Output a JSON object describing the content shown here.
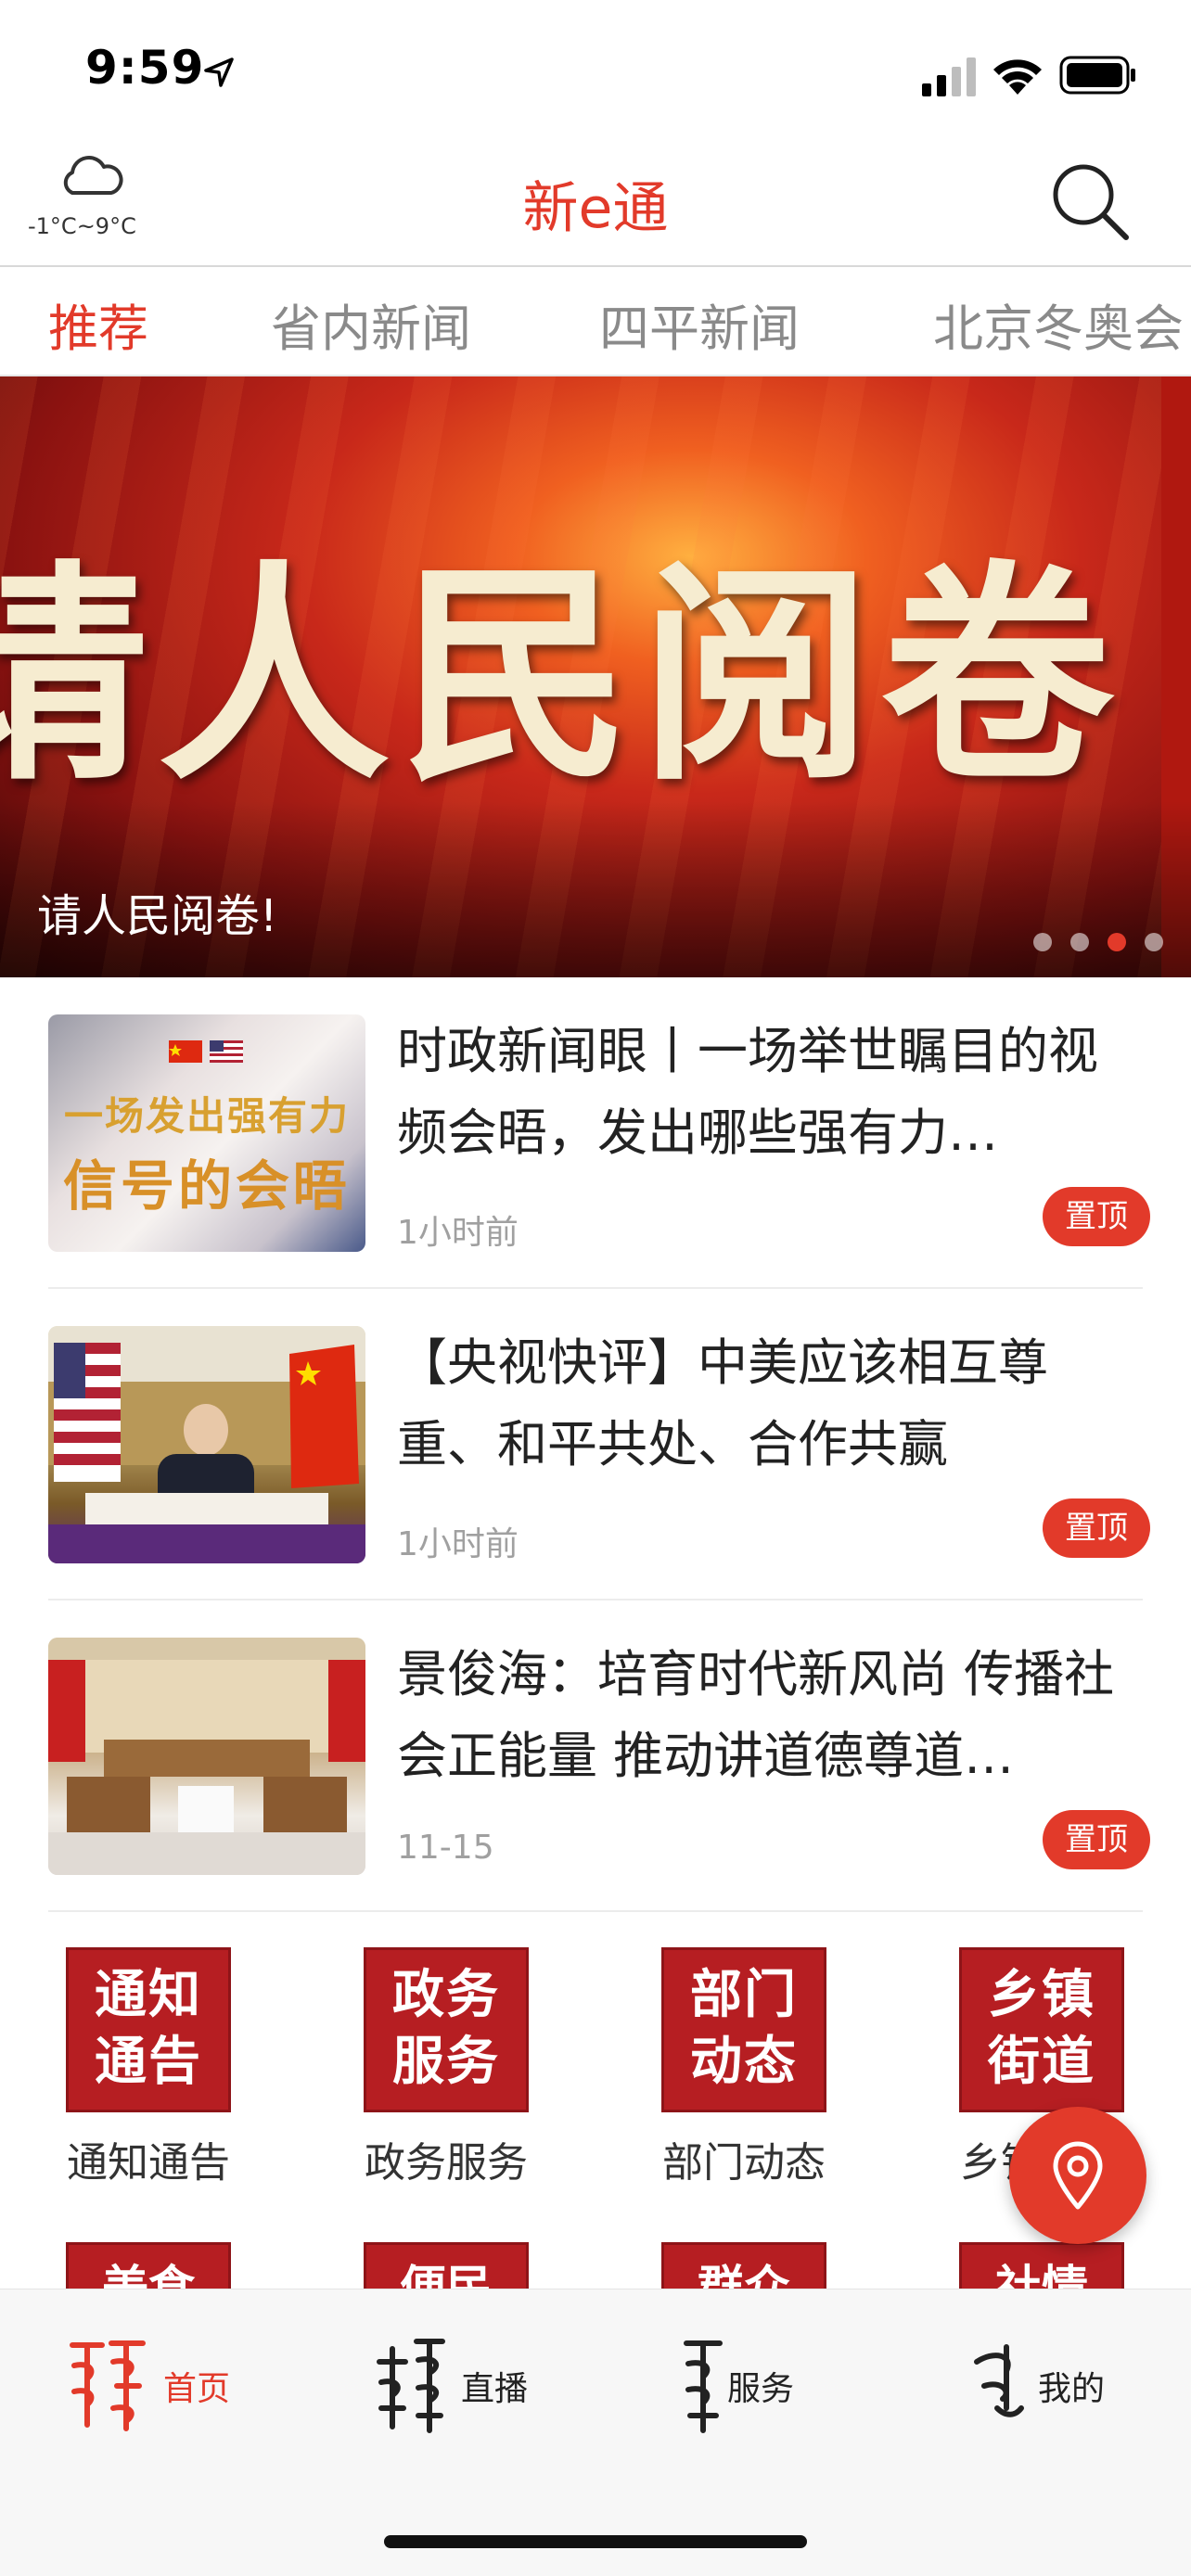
{
  "status_bar": {
    "time": "9:59"
  },
  "header": {
    "weather_range": "-1°C~9°C",
    "title": "新e通"
  },
  "tabs": [
    {
      "label": "推荐",
      "active": true
    },
    {
      "label": "省内新闻",
      "active": false
    },
    {
      "label": "四平新闻",
      "active": false
    },
    {
      "label": "北京冬奥会",
      "active": false
    }
  ],
  "banner": {
    "big_text": "请人民阅卷",
    "caption": "请人民阅卷!",
    "dot_count": 4,
    "active_dot": 3
  },
  "news": [
    {
      "title": "时政新闻眼丨一场举世瞩目的视频会晤，发出哪些强有力…",
      "time": "1小时前",
      "pin": "置顶",
      "thumb_text_1": "一场发出强有力",
      "thumb_text_2": "信号的会晤"
    },
    {
      "title": "【央视快评】中美应该相互尊重、和平共处、合作共赢",
      "time": "1小时前",
      "pin": "置顶"
    },
    {
      "title": "景俊海：培育时代新风尚 传播社会正能量 推动讲道德尊道…",
      "time": "11-15",
      "pin": "置顶"
    }
  ],
  "services": [
    {
      "tile_1": "通知",
      "tile_2": "通告",
      "label": "通知通告"
    },
    {
      "tile_1": "政务",
      "tile_2": "服务",
      "label": "政务服务"
    },
    {
      "tile_1": "部门",
      "tile_2": "动态",
      "label": "部门动态"
    },
    {
      "tile_1": "乡镇",
      "tile_2": "街道",
      "label": "乡镇街道"
    }
  ],
  "services_row2": [
    "美食",
    "便民",
    "群众",
    "社情"
  ],
  "bottom_nav": [
    {
      "label": "首页",
      "active": true,
      "icon": "mongolian-script-icon"
    },
    {
      "label": "直播",
      "active": false,
      "icon": "mongolian-script-icon"
    },
    {
      "label": "服务",
      "active": false,
      "icon": "mongolian-script-icon"
    },
    {
      "label": "我的",
      "active": false,
      "icon": "mongolian-script-icon"
    }
  ],
  "colors": {
    "accent": "#e23a2a",
    "tile": "#b61e22"
  }
}
